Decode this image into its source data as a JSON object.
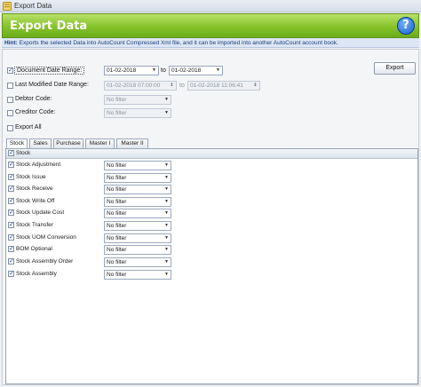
{
  "window": {
    "title": "Export Data"
  },
  "banner": {
    "title": "Export Data",
    "help_glyph": "?"
  },
  "hint": {
    "prefix": "Hint:",
    "text": "Exports the selected Data into AutoCount Compressed Xml file, and it can be imported into another AutoCount account book."
  },
  "filters": {
    "document_date_range": {
      "label": "Document Date Range:",
      "checked": true,
      "from": "01-02-2018",
      "to_label": "to",
      "to": "01-02-2018"
    },
    "last_modified_range": {
      "label": "Last Modified Date Range:",
      "checked": false,
      "from": "01-02-2018 07:00:00",
      "to_label": "to",
      "to": "01-02-2018 11:06:41"
    },
    "debtor_code": {
      "label": "Debtor Code:",
      "checked": false,
      "value": "No filter"
    },
    "creditor_code": {
      "label": "Creditor Code:",
      "checked": false,
      "value": "No filter"
    },
    "export_all": {
      "label": "Export All",
      "checked": false
    }
  },
  "export_button": "Export",
  "tabs": [
    "Stock",
    "Sales",
    "Purchase",
    "Master I",
    "Master II"
  ],
  "active_tab": "Stock",
  "stock_panel": {
    "header_label": "Stock",
    "header_checked": true,
    "rows": [
      {
        "label": "Stock Adjustment",
        "checked": true,
        "filter": "No filter"
      },
      {
        "label": "Stock Issue",
        "checked": true,
        "filter": "No filter"
      },
      {
        "label": "Stock Receive",
        "checked": true,
        "filter": "No filter"
      },
      {
        "label": "Stock Write Off",
        "checked": true,
        "filter": "No filter"
      },
      {
        "label": "Stock Update Cost",
        "checked": true,
        "filter": "No filter"
      },
      {
        "label": "Stock Transfer",
        "checked": true,
        "filter": "No filter"
      },
      {
        "label": "Stock UOM Conversion",
        "checked": true,
        "filter": "No filter"
      },
      {
        "label": "BOM Optional",
        "checked": true,
        "filter": "No filter"
      },
      {
        "label": "Stock Assembly Order",
        "checked": true,
        "filter": "No filter"
      },
      {
        "label": "Stock Assembly",
        "checked": true,
        "filter": "No filter"
      }
    ]
  },
  "colors": {
    "banner_green": "#86c22a",
    "hint_text": "#1f3f7a"
  }
}
